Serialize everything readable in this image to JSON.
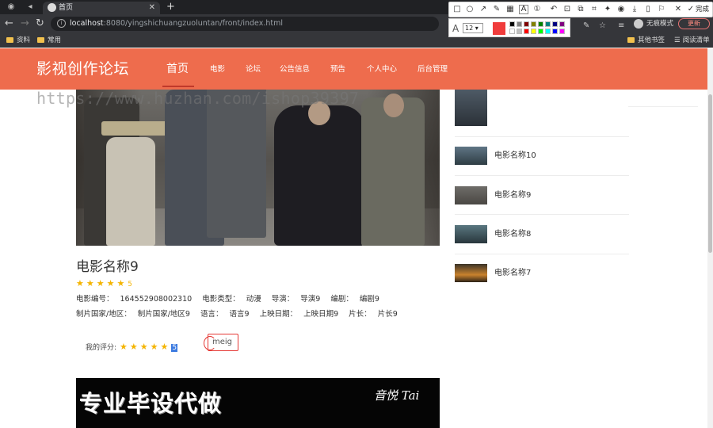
{
  "browser": {
    "tab_title": "首页",
    "url_host": "localhost",
    "url_rest": ":8080/yingshichuangzuoluntan/front/index.html",
    "bookmarks": [
      "资料",
      "常用"
    ],
    "bookmarks_right": [
      "其他书签",
      "阅读清单"
    ],
    "incognito_label": "无痕模式",
    "update_label": "更新"
  },
  "snapshot_tool": {
    "done_label": "完成",
    "font_size": "12",
    "current_color": "#f03c3c",
    "palette": [
      "#000000",
      "#808080",
      "#800000",
      "#808000",
      "#008000",
      "#008080",
      "#000080",
      "#800080",
      "#ffffff",
      "#c0c0c0",
      "#ff0000",
      "#ffff00",
      "#00ff00",
      "#00ffff",
      "#0000ff",
      "#ff00ff"
    ]
  },
  "site": {
    "logo": "影视创作论坛",
    "nav": [
      "首页",
      "电影",
      "论坛",
      "公告信息",
      "预告",
      "个人中心",
      "后台管理"
    ],
    "accent_color": "#ee6c4d"
  },
  "watermark": "https://www.huzhan.com/ishop39397",
  "movie": {
    "title": "电影名称9",
    "stars": "★★★★★",
    "score": "5",
    "line1": [
      {
        "label": "电影编号：",
        "value": "164552908002310"
      },
      {
        "label": "电影类型：",
        "value": "动漫"
      },
      {
        "label": "导演：",
        "value": "导演9"
      },
      {
        "label": "编剧：",
        "value": "编剧9"
      }
    ],
    "line2": [
      {
        "label": "制片国家/地区：",
        "value": "制片国家/地区9"
      },
      {
        "label": "语言：",
        "value": "语言9"
      },
      {
        "label": "上映日期：",
        "value": "上映日期9"
      },
      {
        "label": "片长：",
        "value": "片长9"
      }
    ]
  },
  "my_rating": {
    "label": "我的评分:",
    "stars": "★★★★★",
    "value": "5",
    "input_text": "meig"
  },
  "banner": {
    "text": "专业毕设代做",
    "signature": "音悦 Tai"
  },
  "sidebar": {
    "items": [
      "电影名称10",
      "电影名称9",
      "电影名称8",
      "电影名称7"
    ]
  }
}
